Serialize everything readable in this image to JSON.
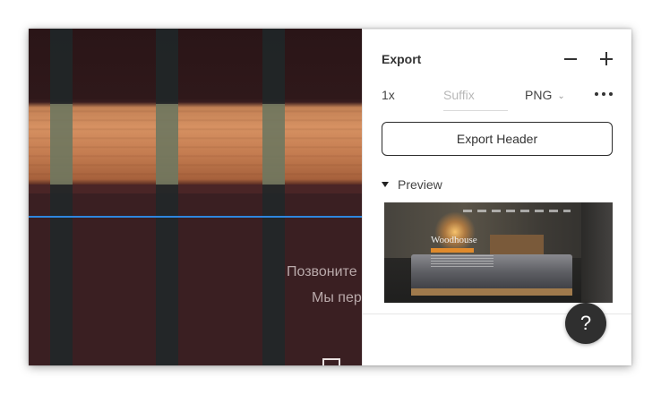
{
  "canvas": {
    "text_line_1": "Позвоните",
    "text_line_2": "Мы пер"
  },
  "export_panel": {
    "title": "Export",
    "remove_icon": "minus-icon",
    "add_icon": "plus-icon",
    "scale": "1x",
    "suffix_value": "",
    "suffix_placeholder": "Suffix",
    "format": "PNG",
    "format_chevron": "chevron-down-icon",
    "more_icon": "more-horizontal-icon",
    "export_button_label": "Export Header",
    "preview_label": "Preview",
    "preview_image": {
      "heading": "Woodhouse"
    }
  },
  "help": {
    "label": "?"
  },
  "colors": {
    "canvas_bg": "#3a1f22",
    "guide_line": "#2e86de",
    "help_button_bg": "#2f2f2f"
  }
}
